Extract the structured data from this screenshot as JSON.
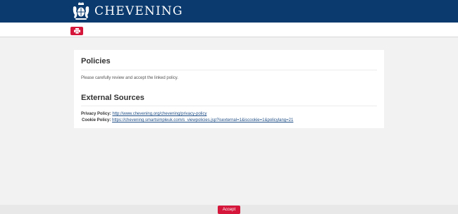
{
  "header": {
    "brand": "CHEVENING",
    "background": "#0b3a6f"
  },
  "toolbar": {
    "print_icon": "print-icon",
    "button_color": "#d4173b"
  },
  "card": {
    "title": "Policies",
    "intro": "Please carefully review and accept the linked policy.",
    "section_title": "External Sources",
    "policies": [
      {
        "label": "Privacy Policy:",
        "link": "http://www.chevening.org/chevening/privacy-policy"
      },
      {
        "label": "Cookie Policy:",
        "link": "https://chevening.smartsimpleuk.com/s_viewpolicies.jsp?isexternal=1&iscookie=1&policylang=21"
      }
    ],
    "link_color": "#1f4e86"
  },
  "footer": {
    "accept_label": "Accept"
  }
}
